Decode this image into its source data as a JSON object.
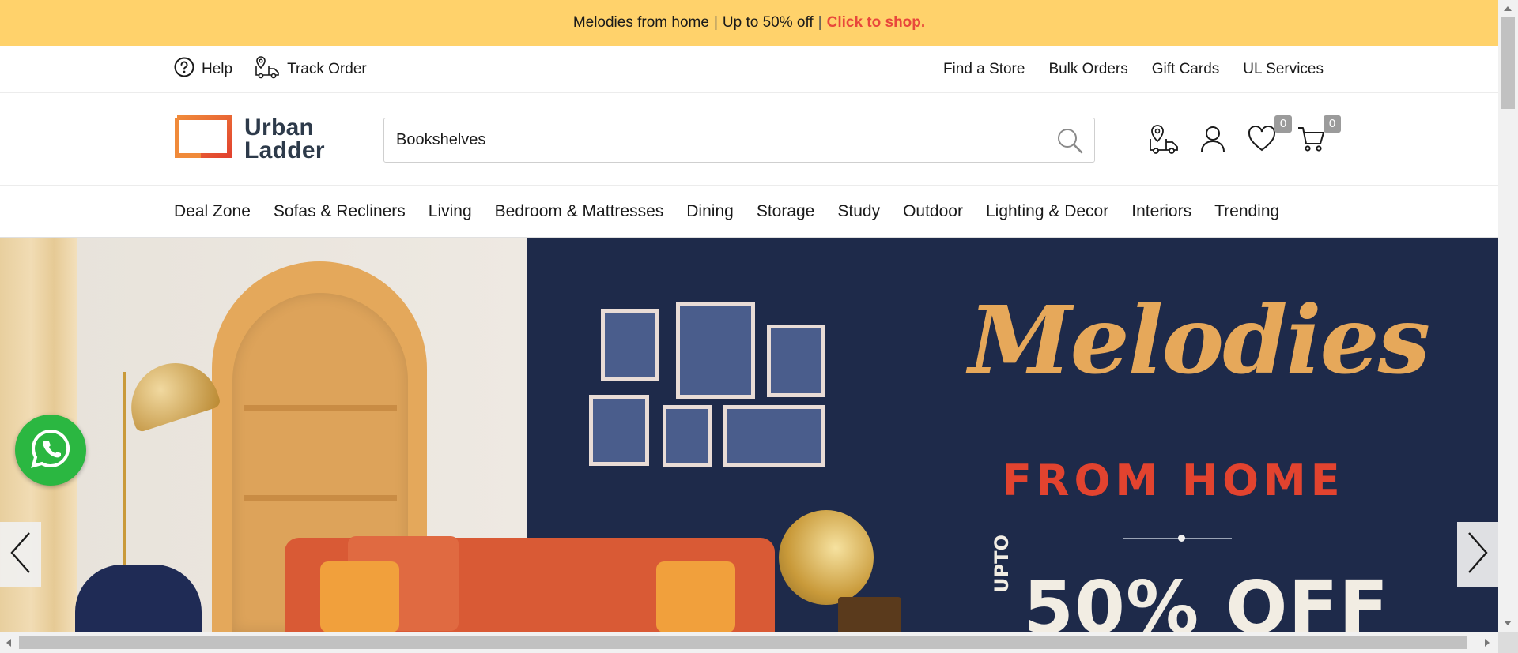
{
  "promo": {
    "text": "Melodies from home",
    "sep1": "|",
    "offer": "Up to 50% off",
    "sep2": "|",
    "cta": "Click to shop."
  },
  "util": {
    "help": "Help",
    "track_order": "Track Order",
    "links": [
      "Find a Store",
      "Bulk Orders",
      "Gift Cards",
      "UL Services"
    ]
  },
  "brand": {
    "line1": "Urban",
    "line2": "Ladder",
    "accent_color": "#e8582a"
  },
  "search": {
    "value": "Bookshelves"
  },
  "header_icons": {
    "wishlist_count": "0",
    "cart_count": "0"
  },
  "nav": {
    "items": [
      "Deal Zone",
      "Sofas & Recliners",
      "Living",
      "Bedroom & Mattresses",
      "Dining",
      "Storage",
      "Study",
      "Outdoor",
      "Lighting & Decor",
      "Interiors",
      "Trending"
    ]
  },
  "hero": {
    "title": "Melodies",
    "subtitle": "FROM HOME",
    "upto": "UPTO",
    "discount": "50% OFF",
    "title_color": "#e6a85a",
    "subtitle_color": "#e2432f",
    "background": "#1e2a4a"
  },
  "colors": {
    "promo_bg": "#ffd26b",
    "cta": "#e8473b",
    "whatsapp": "#2bb741"
  }
}
